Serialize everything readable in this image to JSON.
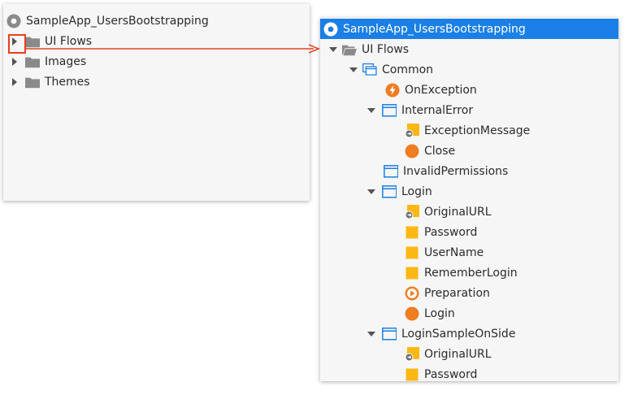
{
  "left": {
    "root": "SampleApp_UsersBootstrapping",
    "items": [
      {
        "label": "UI Flows"
      },
      {
        "label": "Images"
      },
      {
        "label": "Themes"
      }
    ]
  },
  "right": {
    "root": "SampleApp_UsersBootstrapping",
    "rows": [
      {
        "label": "UI Flows"
      },
      {
        "label": "Common"
      },
      {
        "label": "OnException"
      },
      {
        "label": "InternalError"
      },
      {
        "label": "ExceptionMessage"
      },
      {
        "label": "Close"
      },
      {
        "label": "InvalidPermissions"
      },
      {
        "label": "Login"
      },
      {
        "label": "OriginalURL"
      },
      {
        "label": "Password"
      },
      {
        "label": "UserName"
      },
      {
        "label": "RememberLogin"
      },
      {
        "label": "Preparation"
      },
      {
        "label": "Login"
      },
      {
        "label": "LoginSampleOnSide"
      },
      {
        "label": "OriginalURL"
      },
      {
        "label": "Password"
      }
    ]
  },
  "colors": {
    "selection": "#1a7fe6",
    "flow_icon": "#1a7fe6",
    "folder": "#8a8a8a",
    "input_param": "#fbb813",
    "action": "#ef7d22",
    "highlight": "#e8401c"
  },
  "icons": {
    "module": "module-icon",
    "folder": "folder-icon",
    "folder_open": "folder-open-icon",
    "flow": "flow-icon",
    "screen": "screen-icon",
    "exception_handler": "lightning-icon",
    "input_parameter": "input-parameter-icon",
    "local_variable": "local-variable-icon",
    "screen_action": "action-circle-icon",
    "preparation": "play-icon"
  }
}
